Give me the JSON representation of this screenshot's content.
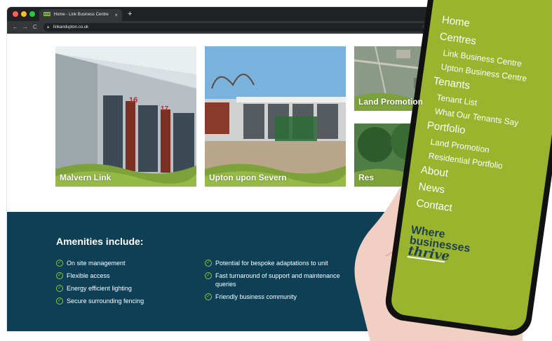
{
  "browser": {
    "tab_title": "Home - Link Business Centre",
    "tab_favicon": "Link",
    "tab_close": "×",
    "new_tab": "+",
    "url": "linkandupton.co.uk",
    "nav_back": "←",
    "nav_forward": "→",
    "nav_reload": "C"
  },
  "tiles": [
    {
      "label": "Malvern Link"
    },
    {
      "label": "Upton upon Severn"
    },
    {
      "label": "Land Promotion"
    },
    {
      "label": "Res"
    }
  ],
  "amenities": {
    "title": "Amenities include:",
    "col1": [
      "On site management",
      "Flexible access",
      "Energy efficient lighting",
      "Secure surrounding fencing"
    ],
    "col2": [
      "Potential for bespoke adaptations to unit",
      "Fast turnaround of support and maintenance queries",
      "Friendly business community"
    ]
  },
  "phone_menu": {
    "items": [
      {
        "label": "Home",
        "level": "top"
      },
      {
        "label": "Centres",
        "level": "top"
      },
      {
        "label": "Link Business Centre",
        "level": "sub"
      },
      {
        "label": "Upton Business Centre",
        "level": "sub"
      },
      {
        "label": "Tenants",
        "level": "top"
      },
      {
        "label": "Tenant List",
        "level": "sub"
      },
      {
        "label": "What Our Tenants Say",
        "level": "sub"
      },
      {
        "label": "Portfolio",
        "level": "top"
      },
      {
        "label": "Land Promotion",
        "level": "sub"
      },
      {
        "label": "Residential Portfolio",
        "level": "sub"
      },
      {
        "label": "About",
        "level": "top"
      },
      {
        "label": "News",
        "level": "top"
      },
      {
        "label": "Contact",
        "level": "top"
      }
    ]
  },
  "brand": {
    "line1": "Where",
    "line2": "businesses",
    "line3": "thrive"
  },
  "colors": {
    "brand_green": "#9ab52d",
    "navy": "#0f3f55",
    "check_green": "#8cc63f"
  }
}
